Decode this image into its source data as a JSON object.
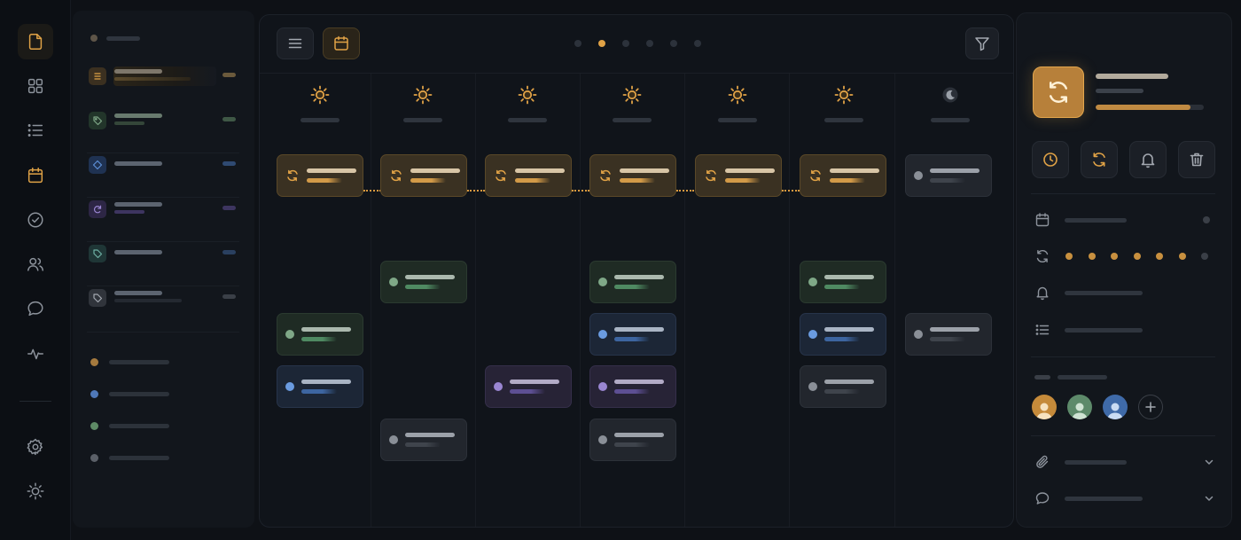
{
  "theme": {
    "accent": "#e0a246",
    "background": "#0e1116",
    "panel": "#12161c",
    "green": "#7fa887",
    "blue": "#5d8fd6",
    "purple": "#9a86d2",
    "gray": "#8a8f97"
  },
  "rail": {
    "items": [
      {
        "icon": "document-icon",
        "active": true
      },
      {
        "icon": "grid-icon",
        "active": false
      },
      {
        "icon": "list-icon",
        "active": false
      },
      {
        "icon": "calendar-icon",
        "active": false,
        "accent": true
      },
      {
        "icon": "check-circle-icon",
        "active": false
      },
      {
        "icon": "users-icon",
        "active": false
      },
      {
        "icon": "chat-bubble-icon",
        "active": false
      },
      {
        "icon": "activity-icon",
        "active": false
      }
    ],
    "bottom": [
      {
        "icon": "gear-icon"
      },
      {
        "icon": "sun-icon"
      }
    ]
  },
  "list_panel": {
    "items": [
      {
        "icon": "list-icon",
        "color": "accent",
        "selected": true
      },
      {
        "icon": "tag-icon",
        "color": "green",
        "selected": false
      },
      {
        "icon": "tag-icon",
        "color": "blue",
        "selected": false
      },
      {
        "icon": "refresh-icon",
        "color": "purple",
        "selected": false
      },
      {
        "icon": "tag-icon",
        "color": "teal",
        "selected": false
      },
      {
        "icon": "tag-icon",
        "color": "gray",
        "selected": false
      }
    ],
    "legend": [
      "accent",
      "blue",
      "green",
      "gray"
    ]
  },
  "board": {
    "toolbar": [
      {
        "icon": "menu-icon",
        "active": false
      },
      {
        "icon": "calendar-icon",
        "active": true
      }
    ],
    "filter_icon": "filter-icon",
    "pager": {
      "count": 6,
      "current": 2
    },
    "days": [
      {
        "icon": "sun-icon"
      },
      {
        "icon": "sun-icon"
      },
      {
        "icon": "sun-icon"
      },
      {
        "icon": "sun-icon"
      },
      {
        "icon": "sun-icon"
      },
      {
        "icon": "sun-icon"
      },
      {
        "icon": "moon-icon"
      }
    ],
    "cards": [
      {
        "day": 0,
        "row": 0,
        "color": "orange",
        "icon": "refresh-icon"
      },
      {
        "day": 1,
        "row": 0,
        "color": "orange",
        "icon": "refresh-icon"
      },
      {
        "day": 2,
        "row": 0,
        "color": "orange",
        "icon": "refresh-icon"
      },
      {
        "day": 3,
        "row": 0,
        "color": "orange",
        "icon": "refresh-icon"
      },
      {
        "day": 4,
        "row": 0,
        "color": "orange",
        "icon": "refresh-icon"
      },
      {
        "day": 5,
        "row": 0,
        "color": "orange",
        "icon": "refresh-icon"
      },
      {
        "day": 6,
        "row": 0,
        "color": "gray",
        "icon": "dot"
      },
      {
        "day": 1,
        "row": 1,
        "color": "green",
        "icon": "dot"
      },
      {
        "day": 3,
        "row": 1,
        "color": "green",
        "icon": "dot"
      },
      {
        "day": 5,
        "row": 1,
        "color": "green",
        "icon": "dot"
      },
      {
        "day": 0,
        "row": 2,
        "color": "green",
        "icon": "dot"
      },
      {
        "day": 3,
        "row": 2,
        "color": "blue",
        "icon": "dot"
      },
      {
        "day": 5,
        "row": 2,
        "color": "blue",
        "icon": "dot"
      },
      {
        "day": 6,
        "row": 2,
        "color": "gray",
        "icon": "dot"
      },
      {
        "day": 0,
        "row": 3,
        "color": "blue",
        "icon": "dot"
      },
      {
        "day": 2,
        "row": 3,
        "color": "purple",
        "icon": "dot"
      },
      {
        "day": 3,
        "row": 3,
        "color": "purple",
        "icon": "dot"
      },
      {
        "day": 5,
        "row": 3,
        "color": "gray",
        "icon": "dot"
      },
      {
        "day": 1,
        "row": 4,
        "color": "gray",
        "icon": "dot"
      },
      {
        "day": 3,
        "row": 4,
        "color": "gray",
        "icon": "dot"
      }
    ]
  },
  "detail": {
    "hero_icon": "refresh-icon",
    "progress": 0.88,
    "actions": [
      {
        "icon": "clock-icon"
      },
      {
        "icon": "refresh-icon"
      },
      {
        "icon": "bell-icon"
      },
      {
        "icon": "trash-icon"
      }
    ],
    "recurrence_steps": 7,
    "recurrence_active": 6,
    "avatars": [
      "accent",
      "green",
      "blue"
    ],
    "add_icon": "plus-icon",
    "sections": [
      {
        "icon": "paperclip-icon",
        "expand_icon": "chevron-down-icon"
      },
      {
        "icon": "chat-bubble-icon",
        "expand_icon": "chevron-down-icon"
      }
    ]
  }
}
